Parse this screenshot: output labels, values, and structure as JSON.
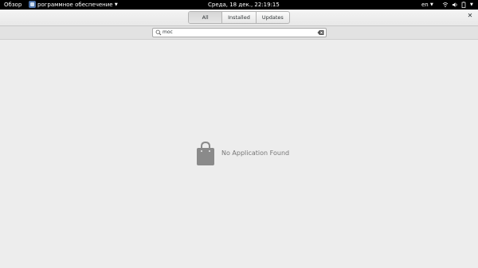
{
  "topbar": {
    "activities_label": "Обзор",
    "app_menu_label": "рограммное обеспечение",
    "clock": "Среда, 18 дек., 22:19:15",
    "keyboard_layout": "en"
  },
  "header": {
    "tabs": [
      {
        "label": "All",
        "active": true
      },
      {
        "label": "Installed",
        "active": false
      },
      {
        "label": "Updates",
        "active": false
      }
    ],
    "close_icon": "close-icon"
  },
  "search": {
    "value": "moc"
  },
  "content": {
    "empty_message": "No Application Found",
    "empty_icon": "shopping-bag-icon",
    "empty_icon_color": "#8a8a8a"
  },
  "colors": {
    "topbar_bg": "#000000",
    "window_bg": "#ededed"
  }
}
